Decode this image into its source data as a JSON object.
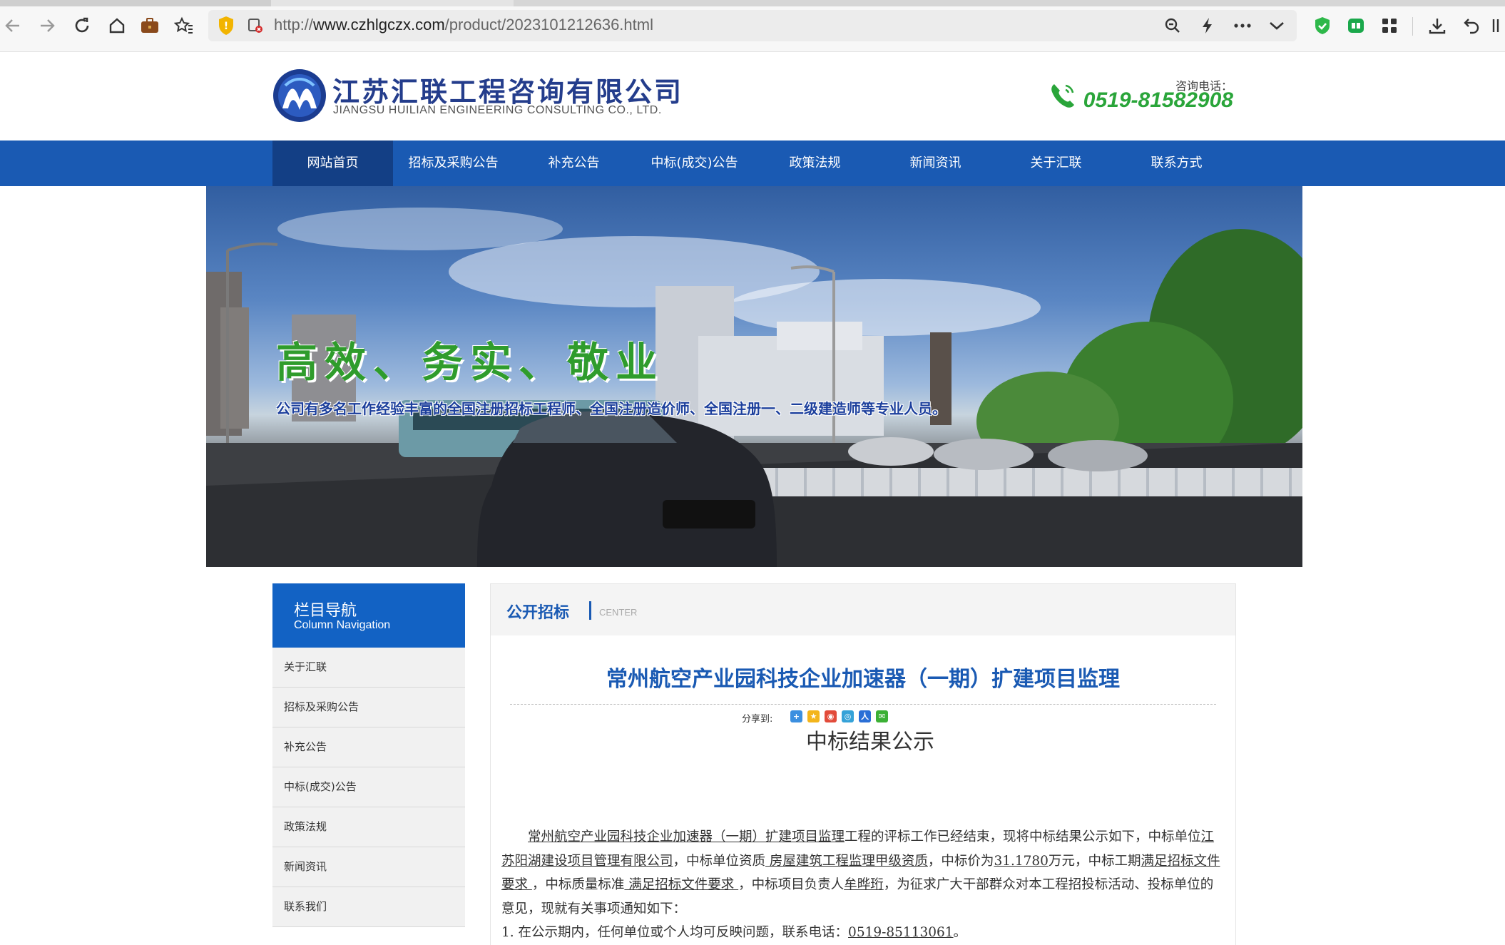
{
  "browser": {
    "url_prefix": "http://",
    "url_host": "www.czhlgczx.com",
    "url_path": "/product/2023101212636.html",
    "toolbar_icons": [
      "back-icon",
      "forward-icon",
      "reload-icon",
      "home-icon",
      "briefcase-icon",
      "favorites-icon",
      "shield-warning-icon",
      "insecure-icon",
      "zoom-icon",
      "flash-icon",
      "more-icon",
      "chevron-down-icon",
      "adblock-icon",
      "extension-icon",
      "apps-grid-icon",
      "download-icon",
      "undo-icon"
    ]
  },
  "header": {
    "company_name": "江苏汇联工程咨询有限公司",
    "company_en": "JIANGSU HUILIAN ENGINEERING CONSULTING CO., LTD.",
    "phone_label": "咨询电话：",
    "phone_number": "0519-81582908",
    "brand_blue": "#243d8c",
    "phone_green": "#2aa53a"
  },
  "nav": {
    "items": [
      {
        "label": "网站首页"
      },
      {
        "label": "招标及采购公告"
      },
      {
        "label": "补充公告"
      },
      {
        "label": "中标(成交)公告"
      },
      {
        "label": "政策法规"
      },
      {
        "label": "新闻资讯"
      },
      {
        "label": "关于汇联"
      },
      {
        "label": "联系方式"
      }
    ],
    "bg_color": "#1a5ab3"
  },
  "banner": {
    "slogan": "高效、务实、敬业",
    "description": "公司有多名工作经验丰富的全国注册招标工程师、全国注册造价师、全国注册一、二级建造师等专业人员。"
  },
  "sidebar": {
    "title": "栏目导航",
    "subtitle": "Column Navigation",
    "items": [
      {
        "label": "关于汇联"
      },
      {
        "label": "招标及采购公告"
      },
      {
        "label": "补充公告"
      },
      {
        "label": "中标(成交)公告"
      },
      {
        "label": "政策法规"
      },
      {
        "label": "新闻资讯"
      },
      {
        "label": "联系我们"
      }
    ]
  },
  "content": {
    "section_title": "公开招标",
    "section_sub": "CENTER",
    "article_title": "常州航空产业园科技企业加速器（一期）扩建项目监理",
    "share_label": "分享到:",
    "doc_heading": "中标结果公示",
    "para": {
      "project": "常州航空产业园科技企业加速器（一期）扩建项目监理",
      "t1": "工程的评标工作已经结束，现将中标结果公示如下，中标单位",
      "winner": "江苏阳湖建设项目管理有限公司",
      "t2": "，中标单位资质",
      "qualification": " 房屋建筑工程监理甲级资质",
      "t3": "，中标价为",
      "price": "31.1780",
      "t4": "万元，中标工期",
      "period": "满足招标文件要求 ",
      "t5": "，中标质量标准",
      "quality": " 满足招标文件要求  ",
      "t6": "，中标项目负责人",
      "manager": "牟晔珩",
      "t7": "，为征求广大干部群众对本工程招投标活动、投标单位的意见，现就有关事项通知如下："
    },
    "item1_text": "1. 在公示期内，任何单位或个人均可反映问题，联系电话：",
    "item1_phone": "0519-85113061",
    "item1_end": "。"
  }
}
